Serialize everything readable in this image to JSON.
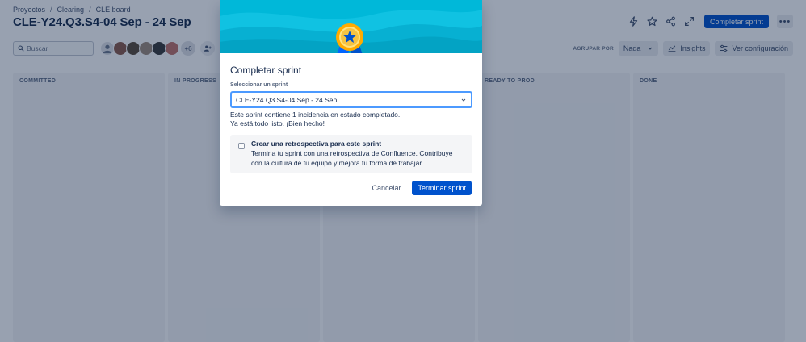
{
  "breadcrumb": [
    "Proyectos",
    "Clearing",
    "CLE board"
  ],
  "board_title": "CLE-Y24.Q3.S4-04 Sep - 24 Sep",
  "toolbar": {
    "complete_sprint_label": "Completar sprint",
    "more_label": "•••"
  },
  "search": {
    "placeholder": "Buscar"
  },
  "avatars": {
    "colors": [
      "#6b778c",
      "#8b5a4a",
      "#5a4a3a",
      "#9e8a7a",
      "#3a3a3a",
      "#c0736a"
    ],
    "more_label": "+6"
  },
  "group_by": {
    "label": "AGRUPAR POR",
    "value": "Nada"
  },
  "insights_label": "Insights",
  "settings_label": "Ver configuración",
  "columns": [
    "COMMITTED",
    "IN PROGRESS",
    "",
    "READY TO PROD",
    "DONE"
  ],
  "modal": {
    "title": "Completar sprint",
    "select_label": "Seleccionar un sprint",
    "select_value": "CLE-Y24.Q3.S4-04 Sep - 24 Sep",
    "info_line1": "Este sprint contiene 1 incidencia en estado completado.",
    "info_line2": "Ya está todo listo. ¡Bien hecho!",
    "retro_title": "Crear una retrospectiva para este sprint",
    "retro_desc": "Termina tu sprint con una retrospectiva de Confluence. Contribuye con la cultura de tu equipo y mejora tu forma de trabajar.",
    "cancel_label": "Cancelar",
    "confirm_label": "Terminar sprint"
  },
  "colors": {
    "primary": "#0052cc",
    "banner": "#00b8d9",
    "medal": "#f6c342",
    "ribbon": "#0065ff"
  }
}
